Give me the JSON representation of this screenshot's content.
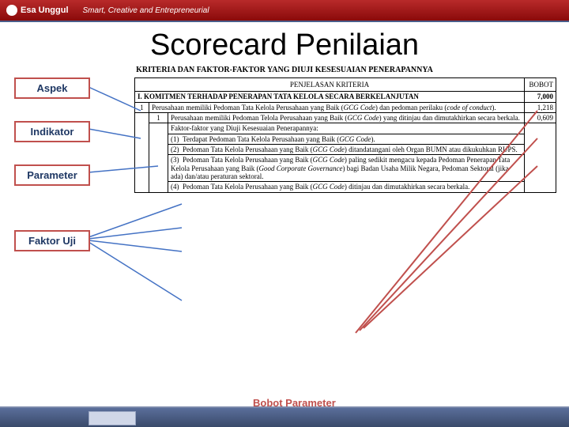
{
  "topbar": {
    "logo": "Esa Unggul",
    "tagline": "Smart, Creative and Entrepreneurial"
  },
  "title": "Scorecard Penilaian",
  "subtitle": "KRITERIA DAN FAKTOR-FAKTOR YANG DIUJI KESESUAIAN PENERAPANNYA",
  "labels": {
    "aspek": "Aspek",
    "indikator": "Indikator",
    "parameter": "Parameter",
    "faktor": "Faktor Uji"
  },
  "head": {
    "penjelasan": "PENJELASAN KRITERIA",
    "bobot": "BOBOT"
  },
  "sectionI": {
    "no": "I.",
    "text": "KOMITMEN TERHADAP PENERAPAN TATA KELOLA SECARA BERKELANJUTAN",
    "bobot": "7,000"
  },
  "row1": {
    "no": "1",
    "text1": "Perusahaan memiliki Pedoman Tata Kelola Perusahaan yang Baik (",
    "ital1": "GCG Code",
    "text2": ") dan pedoman perilaku (",
    "ital2": "code of conduct",
    "text3": ").",
    "bobot": "1,218"
  },
  "row11": {
    "no": "1",
    "text1": "Perusahaan memiliki Pedoman Telola Perusahaan yang Baik (",
    "ital1": "GCG Code",
    "text2": ") yang ditinjau dan dimutakhirkan secara berkala.",
    "bobot": "0,609"
  },
  "rowF": {
    "text": "Faktor-faktor yang Diuji Kesesuaian Penerapannya:"
  },
  "f1": {
    "no": "(1)",
    "text1": "Terdapat Pedoman Tata Kelola Perusahaan yang Baik (",
    "ital": "GCG Code",
    "text2": ")."
  },
  "f2": {
    "no": "(2)",
    "text1": "Pedoman Tata Kelola Perusahaan yang Baik (",
    "ital": "GCG Code",
    "text2": ") ditandatangani oleh Organ BUMN atau dikukuhkan RUPS."
  },
  "f3": {
    "no": "(3)",
    "text1": "Pedoman Tata Kelola Perusahaan yang Baik (",
    "ital": "GCG Code",
    "text2": ") paling sedikit mengacu kepada Pedoman Penerapan Tata Kelola Perusahaan yang Baik (",
    "ital2": "Good Corporate Governance",
    "text3": ") bagi Badan Usaha Milik Negara, Pedoman Sektoral (jika ada) dan/atau peraturan sektoral."
  },
  "f4": {
    "no": "(4)",
    "text1": "Pedoman Tata Kelola Perusahaan yang Baik (",
    "ital": "GCG Code",
    "text2": ") ditinjau dan dimutakhirkan secara berkala."
  },
  "bobot_label": "Bobot Parameter"
}
